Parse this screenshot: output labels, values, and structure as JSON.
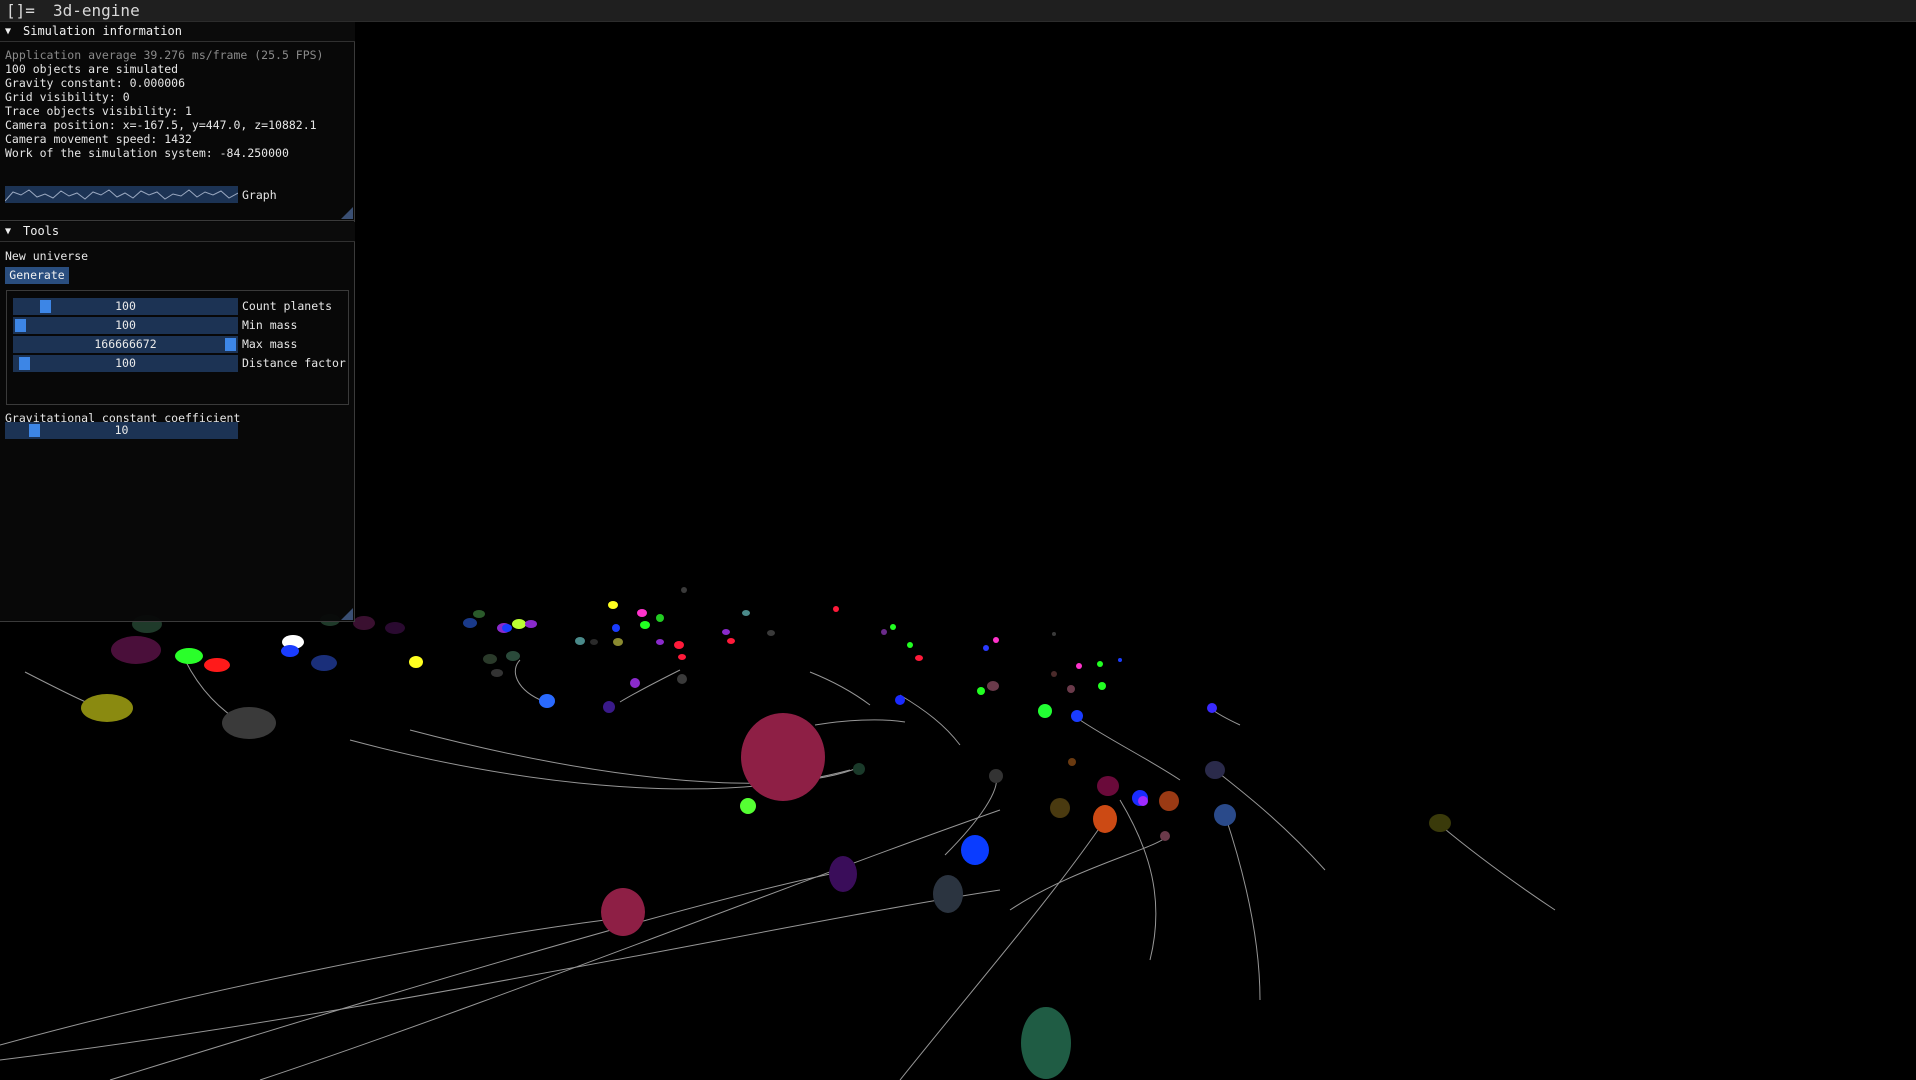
{
  "titlebar": {
    "menu_glyph": "[]=",
    "title": "3d-engine"
  },
  "sim_info": {
    "header": "Simulation information",
    "fps_line": "Application average 39.276 ms/frame (25.5 FPS)",
    "objects_line": "100 objects are simulated",
    "gravity_line": "Gravity constant: 0.000006",
    "grid_line": "Grid visibility: 0",
    "trace_line": "Trace objects visibility: 1",
    "camera_line": "Camera position: x=-167.5, y=447.0, z=10882.1",
    "speed_line": "Camera movement speed: 1432",
    "work_line": "Work of the simulation system: -84.250000",
    "graph_label": "Graph"
  },
  "tools": {
    "header": "Tools",
    "new_universe_label": "New universe",
    "generate_label": "Generate",
    "sliders": [
      {
        "value": "100",
        "label": "Count planets",
        "level": 0.12
      },
      {
        "value": "100",
        "label": "Min mass",
        "level": 0.0
      },
      {
        "value": "166666672",
        "label": "Max mass",
        "level": 1.0
      },
      {
        "value": "100",
        "label": "Distance factor",
        "level": 0.02
      }
    ],
    "grav_label": "Gravitational constant coefficient",
    "grav_slider": {
      "value": "10",
      "level": 0.1
    }
  },
  "colors": {
    "panel_bg": "#080808",
    "frame_bg": "#1c3354",
    "slider_grab": "#3d86e6",
    "button": "#2a4e7f",
    "trail": "#d9d9d9"
  }
}
